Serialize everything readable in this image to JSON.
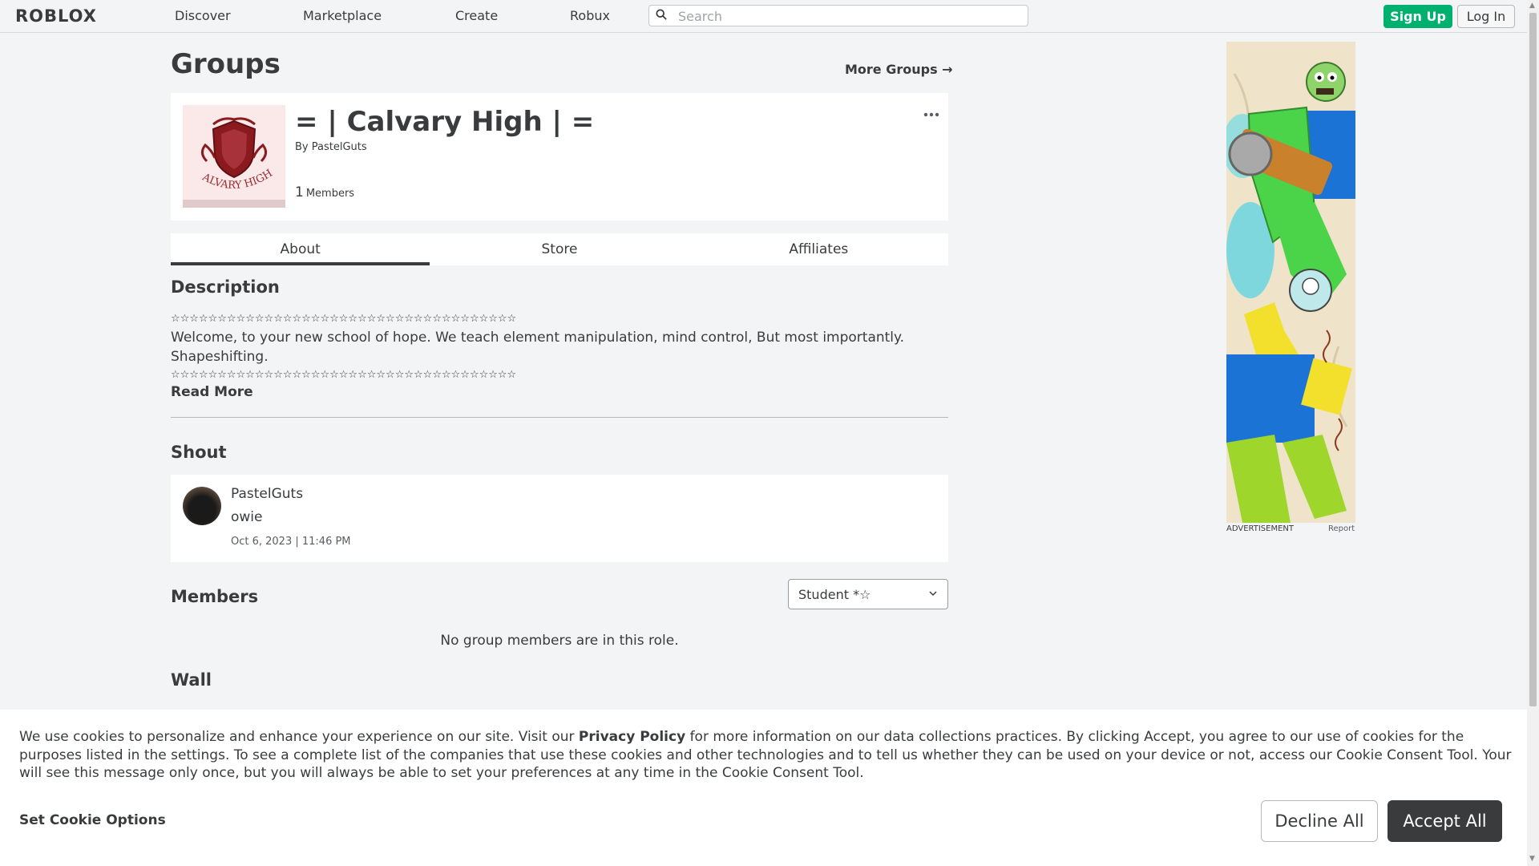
{
  "header": {
    "logo": "ROBLOX",
    "nav": [
      "Discover",
      "Marketplace",
      "Create",
      "Robux"
    ],
    "search_placeholder": "Search",
    "signup_label": "Sign Up",
    "login_label": "Log In"
  },
  "page": {
    "title": "Groups",
    "more_groups": "More Groups →"
  },
  "group": {
    "name": "= | Calvary High | =",
    "by_label": "By",
    "owner": "PastelGuts",
    "member_count": "1",
    "member_label": "Members",
    "emblem_text": "CALVARY HIGH",
    "menu_icon": "ellipsis-icon"
  },
  "tabs": [
    "About",
    "Store",
    "Affiliates"
  ],
  "description": {
    "heading": "Description",
    "stars_top": "☆☆☆☆☆☆☆☆☆☆☆☆☆☆☆☆☆☆☆☆☆☆☆☆☆☆☆☆☆☆☆☆☆☆☆☆☆",
    "text": "Welcome, to your new school of hope. We teach element manipulation, mind control, But most importantly. Shapeshifting.",
    "stars_bottom": "☆☆☆☆☆☆☆☆☆☆☆☆☆☆☆☆☆☆☆☆☆☆☆☆☆☆☆☆☆☆☆☆☆☆☆☆☆",
    "read_more": "Read More"
  },
  "shout": {
    "heading": "Shout",
    "user": "PastelGuts",
    "body": "owie",
    "date": "Oct 6, 2023 | 11:46 PM"
  },
  "members": {
    "heading": "Members",
    "role_selected": "Student *☆",
    "empty_text": "No group members are in this role."
  },
  "wall": {
    "heading": "Wall"
  },
  "ad": {
    "label": "ADVERTISEMENT",
    "report": "Report"
  },
  "cookie": {
    "text_before": "We use cookies to personalize and enhance your experience on our site. Visit our ",
    "privacy_link": "Privacy Policy",
    "text_after": " for more information on our data collections practices. By clicking Accept, you agree to our use of cookies for the purposes listed in the settings. To see a complete list of the companies that use these cookies and other technologies and to tell us whether they can be used on your device or not, access our Cookie Consent Tool. Your will see this message only once, but you will always be able to set your preferences at any time in the Cookie Consent Tool.",
    "options_label": "Set Cookie Options",
    "decline_label": "Decline All",
    "accept_label": "Accept All"
  },
  "colors": {
    "background": "#f2f4f5",
    "signup_green": "#00b06f",
    "text": "#393b3d",
    "accept_bg": "#393b3d"
  }
}
